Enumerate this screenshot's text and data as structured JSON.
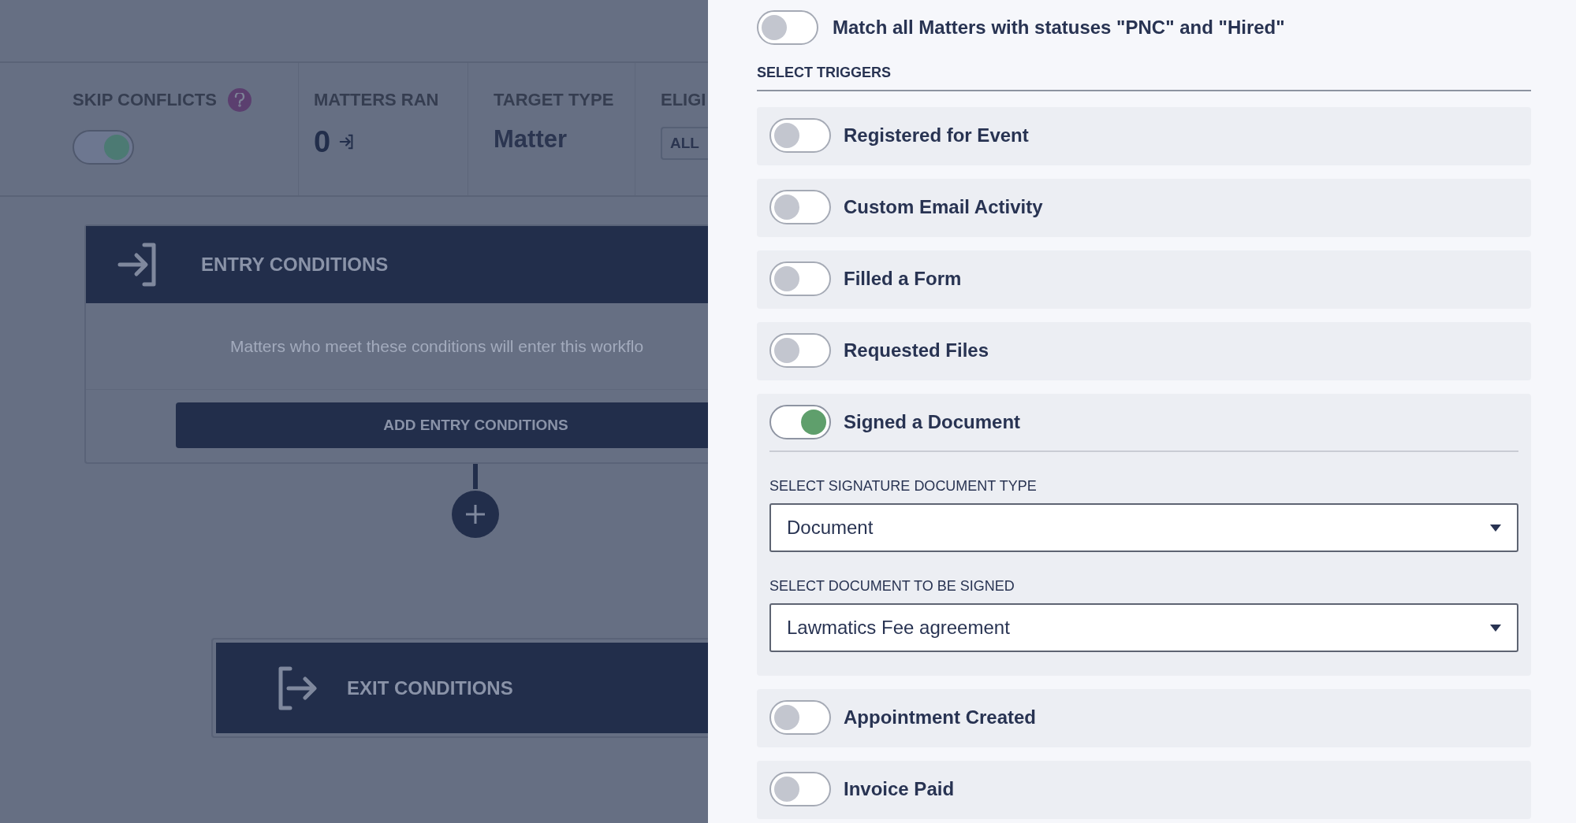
{
  "stats": [
    {
      "kind": "toggle",
      "label": "SKIP CONFLICTS",
      "on": true
    },
    {
      "kind": "count",
      "label": "MATTERS RAN",
      "value": "0"
    },
    {
      "kind": "text",
      "label": "TARGET TYPE",
      "value": "Matter"
    },
    {
      "kind": "select",
      "label": "ELIGI",
      "value": "ALL"
    }
  ],
  "entry_conditions": {
    "title": "ENTRY CONDITIONS",
    "description": "Matters who meet these conditions will enter this workflo",
    "button": "ADD ENTRY CONDITIONS"
  },
  "exit_conditions": {
    "title": "EXIT CONDITIONS"
  },
  "panel": {
    "match_all": {
      "label": "Match all Matters with statuses \"PNC\" and \"Hired\"",
      "on": false
    },
    "section_title": "SELECT TRIGGERS",
    "triggers": [
      {
        "label": "Registered for Event",
        "on": false
      },
      {
        "label": "Custom Email Activity",
        "on": false
      },
      {
        "label": "Filled a Form",
        "on": false
      },
      {
        "label": "Requested Files",
        "on": false
      },
      {
        "label": "Signed a Document",
        "on": true,
        "fields": [
          {
            "label": "SELECT SIGNATURE DOCUMENT TYPE",
            "value": "Document"
          },
          {
            "label": "SELECT DOCUMENT TO BE SIGNED",
            "value": "Lawmatics Fee agreement"
          }
        ]
      },
      {
        "label": "Appointment Created",
        "on": false
      },
      {
        "label": "Invoice Paid",
        "on": false
      }
    ]
  }
}
